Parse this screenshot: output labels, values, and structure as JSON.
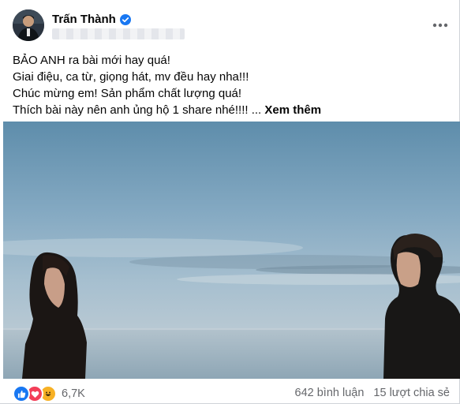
{
  "post": {
    "author": "Trấn Thành",
    "verified": true,
    "more_icon": "more-horizontal-icon",
    "text_lines": [
      "BẢO ANH ra bài mới hay quá!",
      "Giai điệu, ca từ, giọng hát, mv đều hay nha!!!",
      "Chúc mừng em! Sản phẩm chất lượng quá!",
      "Thích bài này nên anh ủng hộ 1 share nhé!!!! ..."
    ],
    "see_more": "Xem thêm"
  },
  "footer": {
    "reactions": [
      "like-icon",
      "love-icon",
      "haha-icon"
    ],
    "reaction_count": "6,7K",
    "comments": "642 bình luận",
    "shares": "15 lượt chia sẻ"
  },
  "colors": {
    "brand_blue": "#1877f2",
    "secondary_text": "#65676b"
  }
}
